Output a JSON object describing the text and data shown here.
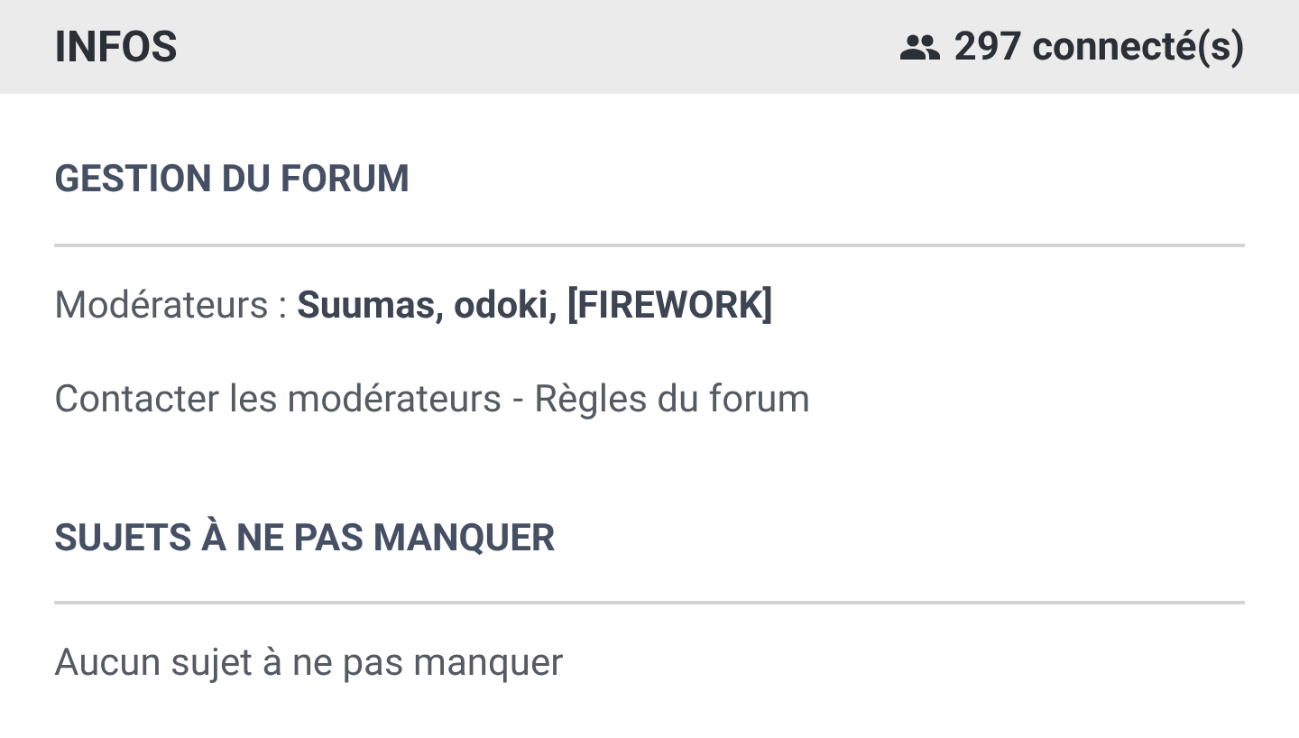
{
  "header": {
    "title": "INFOS",
    "online": "297 connecté(s)"
  },
  "sections": [
    {
      "title": "GESTION DU FORUM",
      "lines": [
        {
          "kind": "text",
          "text": "Modérateurs : **Suumas, odoki, [FIREWORK]**"
        },
        {
          "kind": "links",
          "links": [
            "Contacter les modérateurs",
            "Règles du forum"
          ],
          "separator": "-"
        }
      ]
    },
    {
      "title": "SUJETS À NE PAS MANQUER",
      "lines": [
        {
          "kind": "text",
          "text": "Aucun sujet à ne pas manquer"
        }
      ]
    }
  ]
}
